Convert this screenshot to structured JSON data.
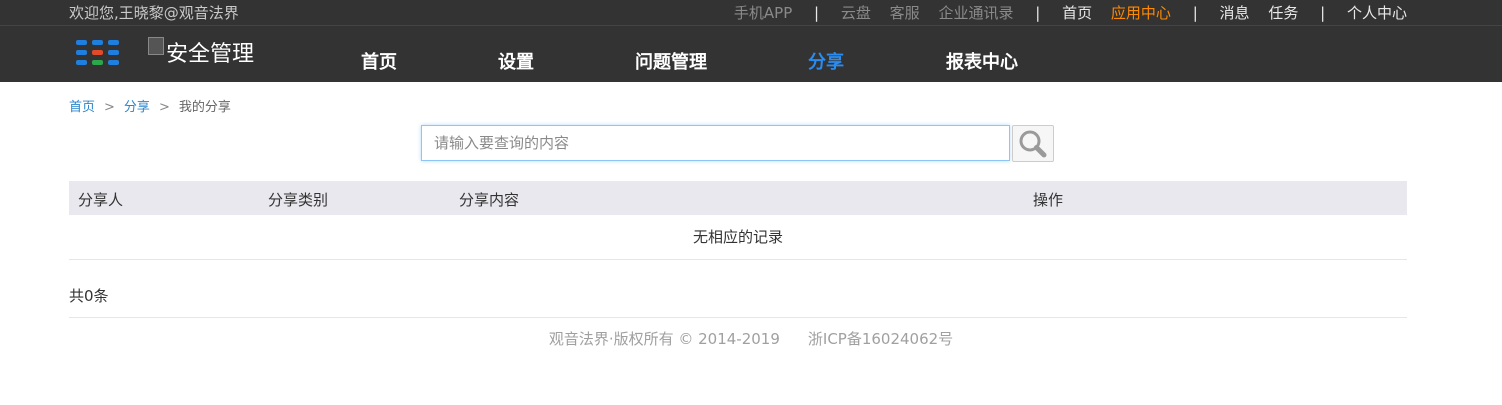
{
  "topbar": {
    "welcome": "欢迎您,王晓黎@观音法界",
    "links_dim": [
      "手机APP",
      "云盘",
      "客服",
      "企业通讯录"
    ],
    "links_main": [
      {
        "label": "首页",
        "active": false
      },
      {
        "label": "应用中心",
        "active": true
      }
    ],
    "links_right": [
      "消息",
      "任务"
    ],
    "personal": "个人中心",
    "separator": "|"
  },
  "logo": {
    "alt": "安全管理"
  },
  "nav": {
    "items": [
      "首页",
      "设置",
      "问题管理",
      "分享",
      "报表中心"
    ],
    "active_index": 3
  },
  "breadcrumb": {
    "items": [
      "首页",
      "分享",
      "我的分享"
    ],
    "arrow": ">"
  },
  "search": {
    "placeholder": "请输入要查询的内容",
    "value": ""
  },
  "table": {
    "columns": [
      "分享人",
      "分享类别",
      "分享内容",
      "操作"
    ],
    "empty_text": "无相应的记录"
  },
  "pagination": {
    "total": "共0条"
  },
  "footer": {
    "copyright": "观音法界·版权所有 © 2014-2019",
    "icp": "浙ICP备16024062号"
  },
  "colors": {
    "bar_bg": "#333333",
    "accent_orange": "#ff8a00",
    "accent_blue": "#2a8cf0",
    "link_blue": "#2b86cc",
    "table_header_bg": "#e9e8ee"
  },
  "icons": [
    "apps-grid-icon",
    "broken-image-icon",
    "search-icon"
  ]
}
